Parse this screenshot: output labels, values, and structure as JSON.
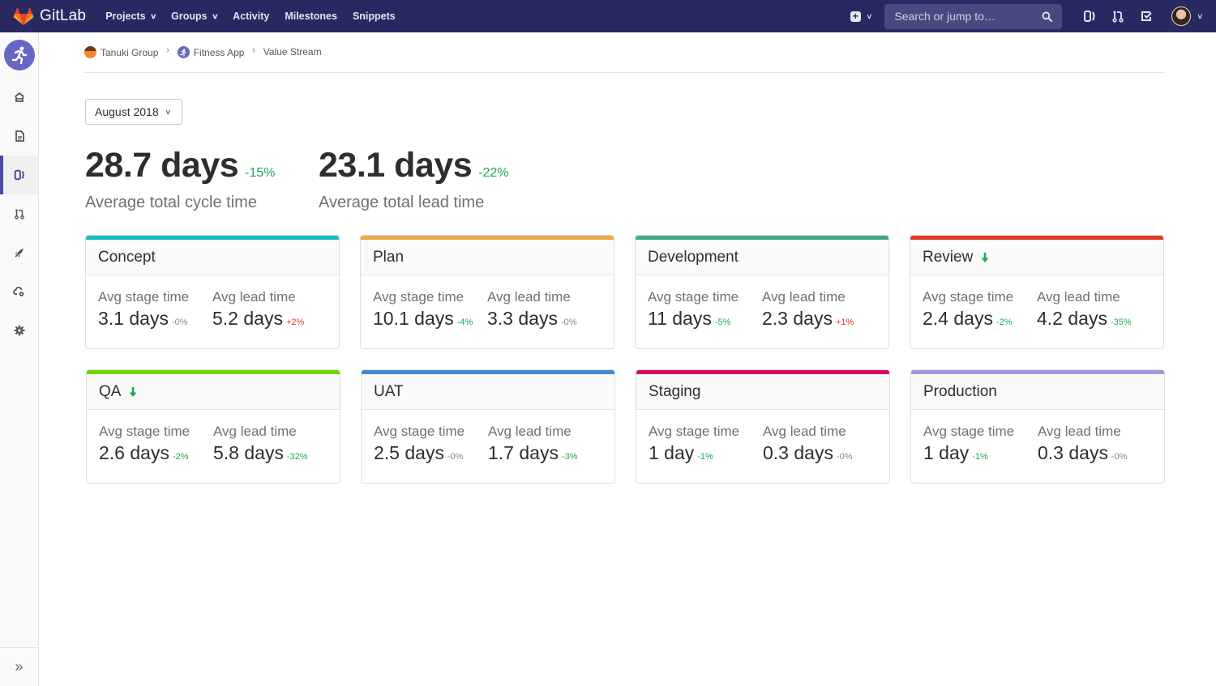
{
  "topbar": {
    "brand": "GitLab",
    "nav": [
      {
        "label": "Projects",
        "dropdown": true
      },
      {
        "label": "Groups",
        "dropdown": true
      },
      {
        "label": "Activity",
        "dropdown": false
      },
      {
        "label": "Milestones",
        "dropdown": false
      },
      {
        "label": "Snippets",
        "dropdown": false
      }
    ],
    "search_placeholder": "Search or jump to…",
    "icons": [
      "plus-square-icon",
      "search-icon",
      "issues-icon",
      "merge-request-icon",
      "todo-icon",
      "user-avatar"
    ]
  },
  "sidebar": {
    "project_avatar_icon": "running-person-icon",
    "items": [
      {
        "name": "home",
        "icon": "home-icon",
        "active": false
      },
      {
        "name": "repository",
        "icon": "document-icon",
        "active": false
      },
      {
        "name": "issues",
        "icon": "issues-icon",
        "active": true
      },
      {
        "name": "merge-requests",
        "icon": "merge-request-icon",
        "active": false
      },
      {
        "name": "ci-cd",
        "icon": "rocket-icon",
        "active": false
      },
      {
        "name": "operations",
        "icon": "cloud-gear-icon",
        "active": false
      },
      {
        "name": "settings",
        "icon": "settings-icon",
        "active": false
      }
    ],
    "collapse_icon": "double-chevron-right-icon"
  },
  "breadcrumb": [
    {
      "label": "Tanuki Group"
    },
    {
      "label": "Fitness App"
    },
    {
      "label": "Value Stream"
    }
  ],
  "date_filter": {
    "selected": "August 2018"
  },
  "summary": [
    {
      "value": "28.7 days",
      "change": "-15%",
      "trend": "good",
      "label": "Average total cycle time"
    },
    {
      "value": "23.1 days",
      "change": "-22%",
      "trend": "good",
      "label": "Average total lead time"
    }
  ],
  "metric_labels": {
    "stage": "Avg stage time",
    "lead": "Avg lead time"
  },
  "stages": [
    {
      "name": "Concept",
      "color": "#17c0c0",
      "down_arrow": false,
      "stage_time": "3.1 days",
      "stage_change": "-0%",
      "stage_trend": "neutral",
      "lead_time": "5.2 days",
      "lead_change": "+2%",
      "lead_trend": "bad"
    },
    {
      "name": "Plan",
      "color": "#eea846",
      "down_arrow": false,
      "stage_time": "10.1 days",
      "stage_change": "-4%",
      "stage_trend": "good",
      "lead_time": "3.3 days",
      "lead_change": "-0%",
      "lead_trend": "neutral"
    },
    {
      "name": "Development",
      "color": "#3faa80",
      "down_arrow": false,
      "stage_time": "11 days",
      "stage_change": "-5%",
      "stage_trend": "good",
      "lead_time": "2.3 days",
      "lead_change": "+1%",
      "lead_trend": "bad"
    },
    {
      "name": "Review",
      "color": "#e03a24",
      "down_arrow": true,
      "stage_time": "2.4 days",
      "stage_change": "-2%",
      "stage_trend": "good",
      "lead_time": "4.2 days",
      "lead_change": "-35%",
      "lead_trend": "good"
    },
    {
      "name": "QA",
      "color": "#6dd400",
      "down_arrow": true,
      "stage_time": "2.6 days",
      "stage_change": "-2%",
      "stage_trend": "good",
      "lead_time": "5.8 days",
      "lead_change": "-32%",
      "lead_trend": "good"
    },
    {
      "name": "UAT",
      "color": "#3f8bd0",
      "down_arrow": false,
      "stage_time": "2.5 days",
      "stage_change": "-0%",
      "stage_trend": "neutral",
      "lead_time": "1.7 days",
      "lead_change": "-3%",
      "lead_trend": "good"
    },
    {
      "name": "Staging",
      "color": "#d60765",
      "down_arrow": false,
      "stage_time": "1 day",
      "stage_change": "-1%",
      "stage_trend": "good",
      "lead_time": "0.3 days",
      "lead_change": "-0%",
      "lead_trend": "neutral"
    },
    {
      "name": "Production",
      "color": "#a197d8",
      "down_arrow": false,
      "stage_time": "1 day",
      "stage_change": "-1%",
      "stage_trend": "good",
      "lead_time": "0.3 days",
      "lead_change": "-0%",
      "lead_trend": "neutral"
    }
  ]
}
